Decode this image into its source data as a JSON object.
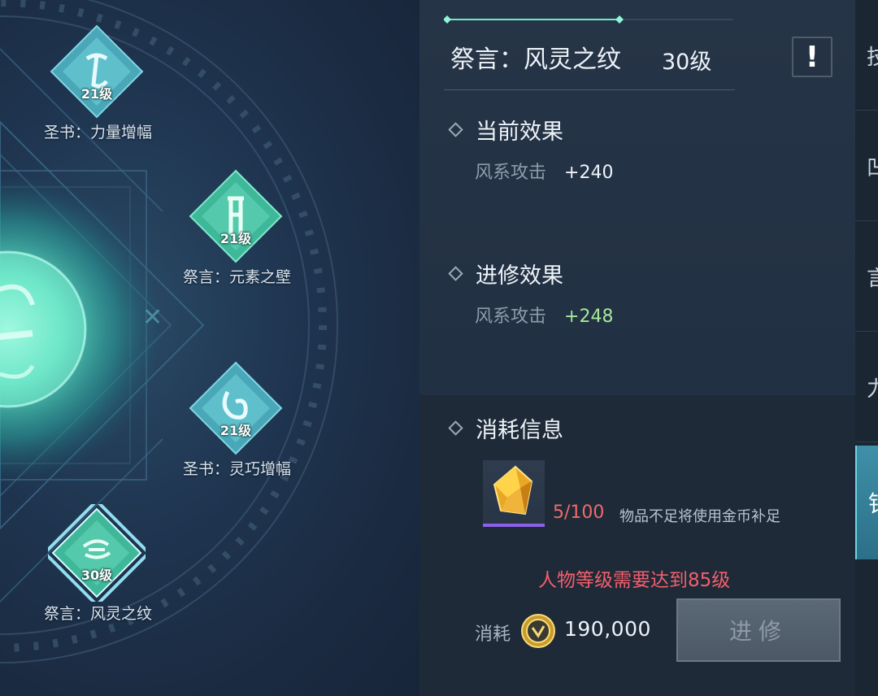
{
  "nodes": [
    {
      "name": "圣书：力量增幅",
      "level": "21级",
      "icon": "scroll-rune-icon"
    },
    {
      "name": "祭言：元素之壁",
      "level": "21级",
      "icon": "wall-rune-icon"
    },
    {
      "name": "圣书：灵巧增幅",
      "level": "21级",
      "icon": "swirl-rune-icon"
    },
    {
      "name": "祭言：风灵之纹",
      "level": "30级",
      "icon": "wind-rune-icon"
    }
  ],
  "detail": {
    "title": "祭言：风灵之纹",
    "level": "30级",
    "info_button": "!",
    "current_effect": {
      "heading": "当前效果",
      "stat": "风系攻击",
      "value": "+240"
    },
    "next_effect": {
      "heading": "进修效果",
      "stat": "风系攻击",
      "value": "+248"
    },
    "cost_info": {
      "heading": "消耗信息",
      "item_icon": "gold-crystal-icon",
      "item_count": "5/100",
      "item_note": "物品不足将使用金币补足",
      "requirement": "人物等级需要达到85级",
      "cost_label": "消耗",
      "cost_value": "190,000",
      "upgrade_button": "进修"
    }
  },
  "tabs": [
    "技",
    "凹",
    "言",
    "力"
  ],
  "active_tab": "铭",
  "colors": {
    "accent_cyan": "#6fd4e8",
    "warning_red": "#f45f6a",
    "increase_green": "#a4e89a"
  }
}
